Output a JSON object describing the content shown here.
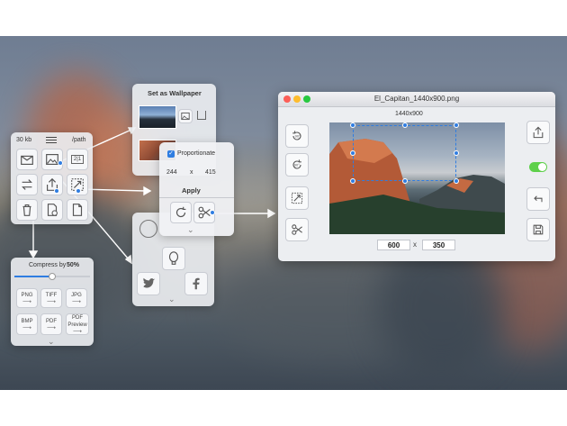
{
  "toolbar_panel": {
    "size_label": "30 kb",
    "path_label": "/path",
    "badge_2x1": "2|1"
  },
  "wallpaper_panel": {
    "title": "Set as Wallpaper"
  },
  "proportion_panel": {
    "checkbox_label": "Proportionate",
    "width_value": "244",
    "times": "x",
    "height_value": "415",
    "apply_label": "Apply"
  },
  "compress_panel": {
    "label": "Compress by",
    "percent": "50%",
    "slider_level": 0.5,
    "formats": [
      {
        "name": "PNG"
      },
      {
        "name": "TIFF"
      },
      {
        "name": "JPG"
      },
      {
        "name": "BMP"
      },
      {
        "name": "PDF"
      },
      {
        "name": "PDF Preview"
      }
    ]
  },
  "window": {
    "title": "El_Capitan_1440x900.png",
    "resolution": "1440x900",
    "width_value": "600",
    "times": "x",
    "height_value": "350"
  },
  "colors": {
    "accent": "#2f7de1",
    "toggle_on": "#5ed04b",
    "close": "#fc5e57",
    "minimize": "#fdbc2e",
    "zoom": "#27c840"
  }
}
